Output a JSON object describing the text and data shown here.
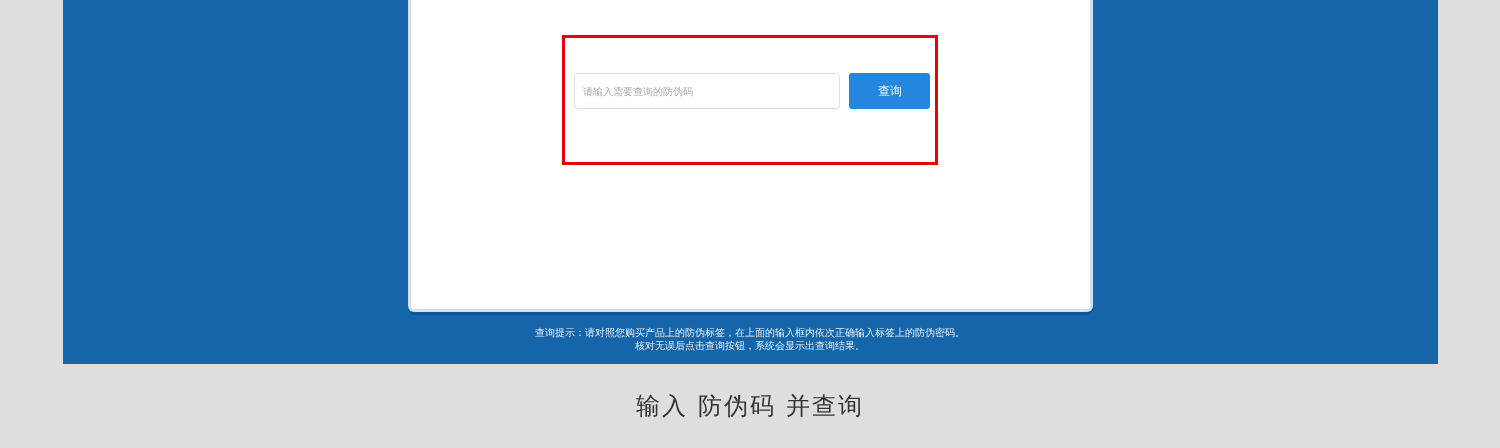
{
  "search": {
    "placeholder": "请输入需要查询的防伪码",
    "button": "查询"
  },
  "hint_lines": [
    "查询提示：请对照您购买产品上的防伪标签，在上面的输入框内依次正确输入标签上的防伪密码。",
    "核对无误后点击查询按钮，系统会显示出查询结果。"
  ],
  "caption": "输入 防伪码 并查询"
}
